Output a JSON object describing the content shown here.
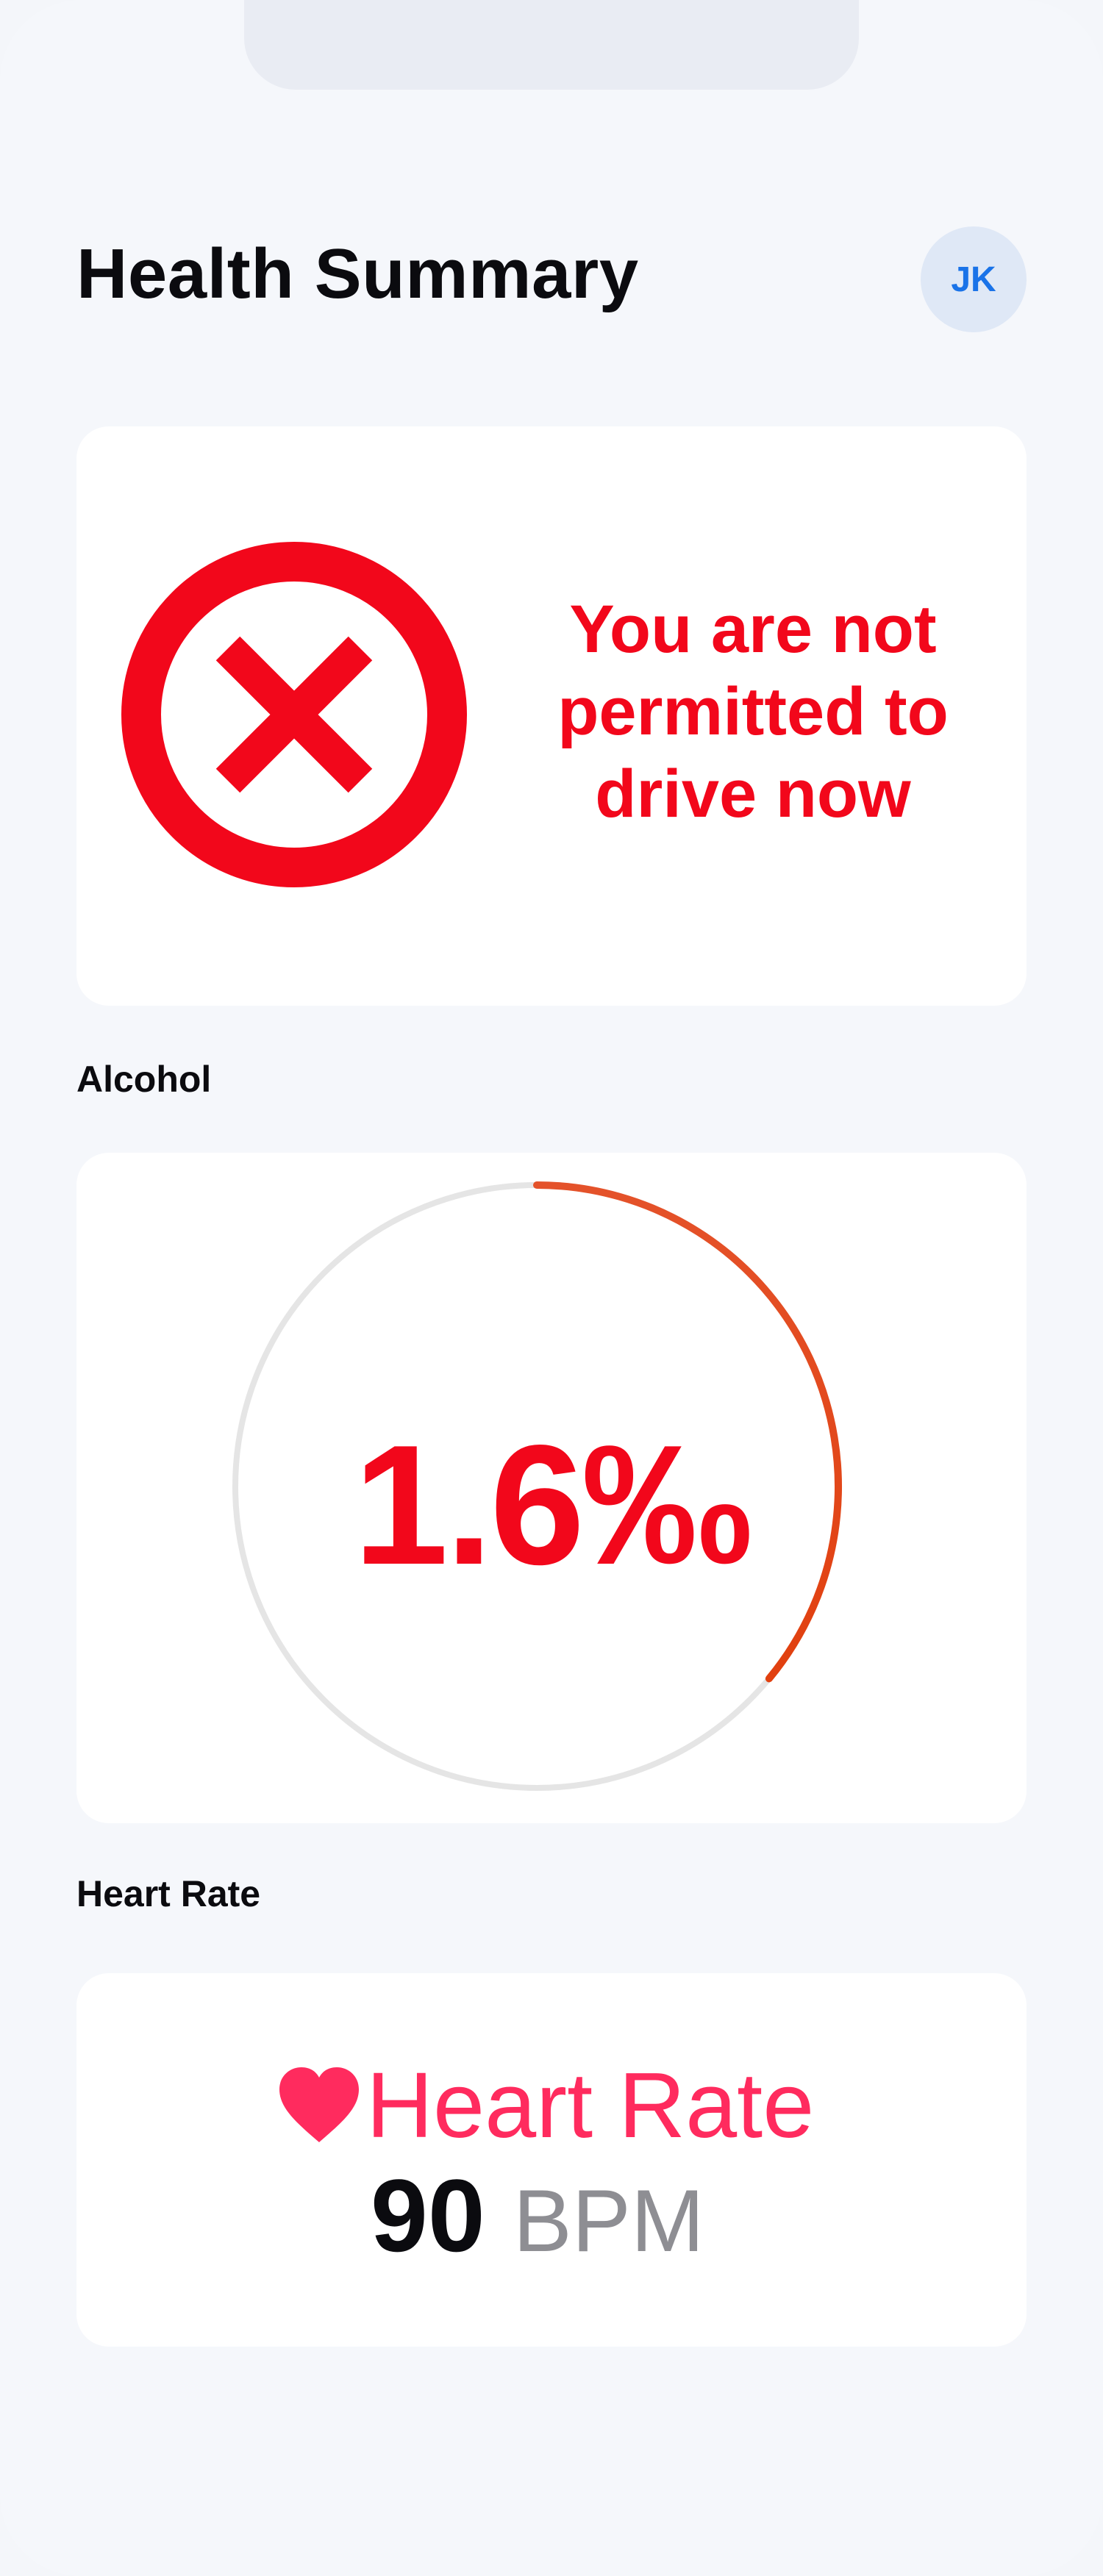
{
  "header": {
    "title": "Health Summary",
    "avatar_initials": "JK"
  },
  "status_card": {
    "icon": "x-circle-icon",
    "message_lines": [
      "You are not",
      "permitted to",
      "drive now"
    ],
    "color": "#f2071b"
  },
  "alcohol": {
    "section_label": "Alcohol",
    "value_text": "1.6‰",
    "gauge_fraction": 0.36,
    "track_color": "#e5e5e5",
    "arc_color_start": "#e4522a",
    "arc_color_end": "#e1400f"
  },
  "heart_rate": {
    "section_label": "Heart Rate",
    "title": "Heart Rate",
    "value": "90",
    "unit": "BPM",
    "icon": "heart-icon",
    "accent_color": "#ff2b5e"
  }
}
